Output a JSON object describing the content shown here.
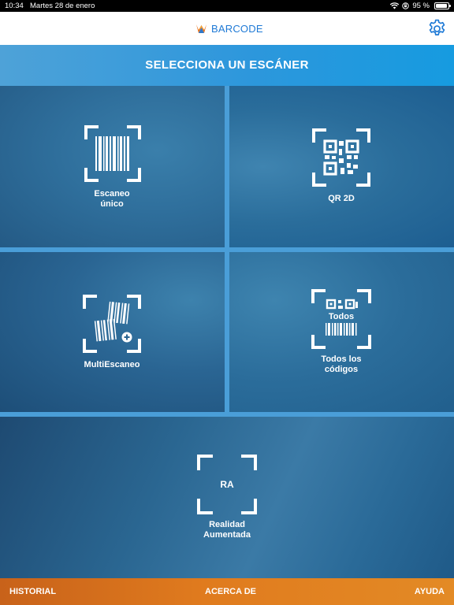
{
  "status_bar": {
    "time": "10:34",
    "date": "Martes 28 de enero",
    "battery": "95 %",
    "icons": [
      "wifi-icon",
      "orientation-lock-icon",
      "battery-icon"
    ]
  },
  "header": {
    "brand": "BARCODE",
    "logo_icon": "barcode-logo-icon",
    "settings_icon": "gear-icon"
  },
  "title": "SELECCIONA UN ESCÁNER",
  "tiles": [
    {
      "id": "single",
      "label_line1": "Escaneo",
      "label_line2": "único",
      "icon": "barcode-scan-icon"
    },
    {
      "id": "qr",
      "label_line1": "QR 2D",
      "label_line2": "",
      "icon": "qr-scan-icon"
    },
    {
      "id": "multi",
      "label_line1": "MultiEscaneo",
      "label_line2": "",
      "icon": "multi-scan-icon"
    },
    {
      "id": "all",
      "label_line1": "Todos los",
      "label_line2": "códigos",
      "icon": "all-codes-icon",
      "icon_text": "Todos"
    },
    {
      "id": "ar",
      "label_line1": "Realidad",
      "label_line2": "Aumentada",
      "icon": "ar-scan-icon",
      "icon_text": "RA"
    }
  ],
  "bottom_nav": {
    "history": "HISTORIAL",
    "about": "ACERCA DE",
    "help": "AYUDA"
  },
  "colors": {
    "brand_blue": "#1f7ad6",
    "title_band": "#2d97dc",
    "bottom_bar": "#e07b1e"
  }
}
